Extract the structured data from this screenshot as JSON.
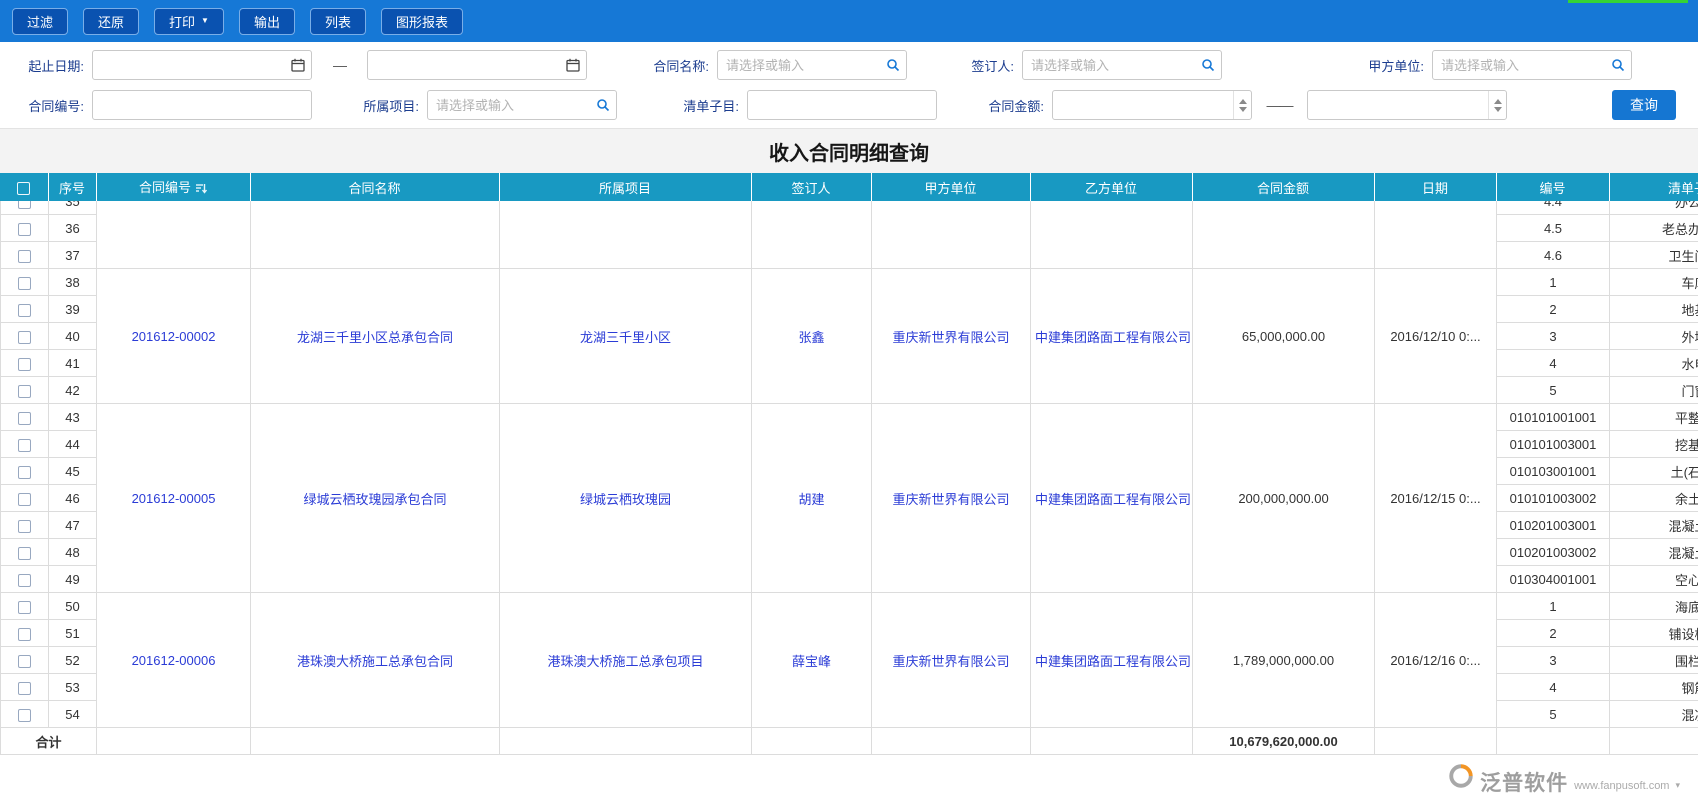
{
  "toolbar": {
    "buttons": [
      {
        "label": "过滤"
      },
      {
        "label": "还原"
      },
      {
        "label": "打印",
        "caret": "▼"
      },
      {
        "label": "输出"
      },
      {
        "label": "列表"
      },
      {
        "label": "图形报表"
      }
    ]
  },
  "filters": {
    "start_end_date_label": "起止日期:",
    "dash": "—",
    "long_dash": "——",
    "contract_name_label": "合同名称:",
    "signer_label": "签订人:",
    "party_a_label": "甲方单位:",
    "contract_no_label": "合同编号:",
    "project_label": "所属项目:",
    "list_item_label": "清单子目:",
    "amount_label": "合同金额:",
    "select_placeholder": "请选择或输入",
    "search_button": "查询"
  },
  "title": "收入合同明细查询",
  "table": {
    "columns": [
      "",
      "序号",
      "合同编号",
      "合同名称",
      "所属项目",
      "签订人",
      "甲方单位",
      "乙方单位",
      "合同金额",
      "日期",
      "编号",
      "清单子目"
    ],
    "groups": [
      {
        "contract": {
          "no": "",
          "name": "",
          "project": "",
          "signer": "",
          "party_a": "",
          "party_b": "",
          "amount": "",
          "date": ""
        },
        "rows": [
          {
            "seq": "35",
            "item_no": "4.4",
            "item_name": "办公室"
          },
          {
            "seq": "36",
            "item_no": "4.5",
            "item_name": "老总办公室"
          },
          {
            "seq": "37",
            "item_no": "4.6",
            "item_name": "卫生间成"
          }
        ]
      },
      {
        "contract": {
          "no": "201612-00002",
          "name": "龙湖三千里小区总承包合同",
          "project": "龙湖三千里小区",
          "signer": "张鑫",
          "party_a": "重庆新世界有限公司",
          "party_b": "中建集团路面工程有限公司",
          "amount": "65,000,000.00",
          "date": "2016/12/10 0:..."
        },
        "rows": [
          {
            "seq": "38",
            "item_no": "1",
            "item_name": "车库"
          },
          {
            "seq": "39",
            "item_no": "2",
            "item_name": "地基"
          },
          {
            "seq": "40",
            "item_no": "3",
            "item_name": "外墙"
          },
          {
            "seq": "41",
            "item_no": "4",
            "item_name": "水电"
          },
          {
            "seq": "42",
            "item_no": "5",
            "item_name": "门窗"
          }
        ]
      },
      {
        "contract": {
          "no": "201612-00005",
          "name": "绿城云栖玫瑰园承包合同",
          "project": "绿城云栖玫瑰园",
          "signer": "胡建",
          "party_a": "重庆新世界有限公司",
          "party_b": "中建集团路面工程有限公司",
          "amount": "200,000,000.00",
          "date": "2016/12/15 0:..."
        },
        "rows": [
          {
            "seq": "43",
            "item_no": "010101001001",
            "item_name": "平整场"
          },
          {
            "seq": "44",
            "item_no": "010101003001",
            "item_name": "挖基础"
          },
          {
            "seq": "45",
            "item_no": "010103001001",
            "item_name": "土(石)方"
          },
          {
            "seq": "46",
            "item_no": "010101003002",
            "item_name": "余土外"
          },
          {
            "seq": "47",
            "item_no": "010201003001",
            "item_name": "混凝土浇"
          },
          {
            "seq": "48",
            "item_no": "010201003002",
            "item_name": "混凝土浇"
          },
          {
            "seq": "49",
            "item_no": "010304001001",
            "item_name": "空心砖"
          }
        ]
      },
      {
        "contract": {
          "no": "201612-00006",
          "name": "港珠澳大桥施工总承包合同",
          "project": "港珠澳大桥施工总承包项目",
          "signer": "薛宝峰",
          "party_a": "重庆新世界有限公司",
          "party_b": "中建集团路面工程有限公司",
          "amount": "1,789,000,000.00",
          "date": "2016/12/16 0:..."
        },
        "rows": [
          {
            "seq": "50",
            "item_no": "1",
            "item_name": "海底挖"
          },
          {
            "seq": "51",
            "item_no": "2",
            "item_name": "铺设桥梁"
          },
          {
            "seq": "52",
            "item_no": "3",
            "item_name": "围栏工"
          },
          {
            "seq": "53",
            "item_no": "4",
            "item_name": "钢筋"
          },
          {
            "seq": "54",
            "item_no": "5",
            "item_name": "混凝"
          }
        ]
      }
    ],
    "total": {
      "label": "合计",
      "amount": "10,679,620,000.00"
    }
  },
  "watermark": {
    "brand": "泛普软件",
    "url": "www.fanpusoft.com"
  },
  "colors": {
    "toolbar_bg": "#1678d6",
    "toolbar_button_bg": "#0a52b0",
    "table_header_bg": "#1899c2",
    "link_blue": "#2b3cd6",
    "accent_green": "#35d435"
  }
}
